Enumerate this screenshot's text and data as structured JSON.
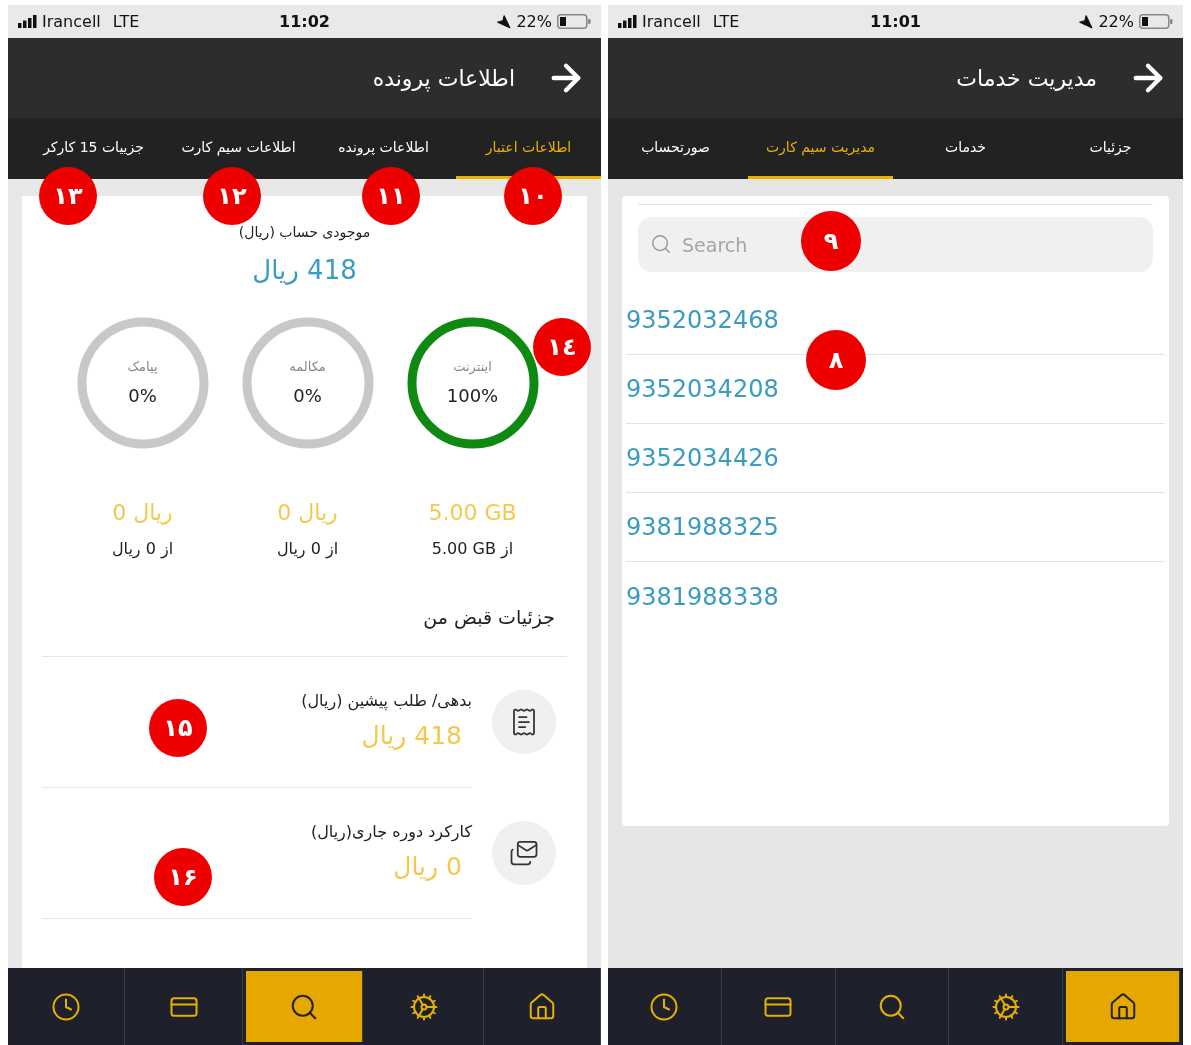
{
  "profile_screen": {
    "status_bar": {
      "carrier": "Irancell",
      "network": "LTE",
      "time": "11:02",
      "battery": "22%"
    },
    "header": {
      "title": "اطلاعات پرونده"
    },
    "tabs": [
      {
        "label": "اطلاعات اعتبار",
        "selected": true
      },
      {
        "label": "اطلاعات پرونده",
        "selected": false
      },
      {
        "label": "اطلاعات سیم کارت",
        "selected": false
      },
      {
        "label": "جزییات 15 کارکر",
        "selected": false
      }
    ],
    "balance": {
      "label": "موجودی حساب (ریال)",
      "amount": "418 ریال"
    },
    "gauges": [
      {
        "label": "اینترنت",
        "percent": "100%",
        "color": "#0e8a12",
        "used": "5.00 GB",
        "total": "5.00 GB از"
      },
      {
        "label": "مکالمه",
        "percent": "0%",
        "color": "#c8c8c8",
        "used": "0 ریال",
        "total": "از 0 ریال"
      },
      {
        "label": "پیامک",
        "percent": "0%",
        "color": "#c8c8c8",
        "used": "0 ریال",
        "total": "از 0 ریال"
      }
    ],
    "bill": {
      "heading": "جزئیات قبض من",
      "rows": [
        {
          "kind": "receipt",
          "title": "بدهی/ طلب پیشین (ریال)",
          "amount": "418 ریال"
        },
        {
          "kind": "payment",
          "title": "کارکرد دوره جاری(ریال)",
          "amount": "0 ریال"
        }
      ]
    },
    "nav": [
      {
        "kind": "clock",
        "selected": false
      },
      {
        "kind": "card",
        "selected": false
      },
      {
        "kind": "search",
        "selected": true
      },
      {
        "kind": "gear",
        "selected": false
      },
      {
        "kind": "home",
        "selected": false
      }
    ],
    "markers": [
      "۱۰",
      "۱۱",
      "۱۲",
      "۱۳",
      "١٤",
      "۱۵",
      "۱۶"
    ]
  },
  "services_screen": {
    "status_bar": {
      "carrier": "Irancell",
      "network": "LTE",
      "time": "11:01",
      "battery": "22%"
    },
    "header": {
      "title": "مدیریت خدمات"
    },
    "tabs": [
      {
        "label": "جزئیات",
        "selected": false
      },
      {
        "label": "خدمات",
        "selected": false
      },
      {
        "label": "مدیریت سیم کارت",
        "selected": true
      },
      {
        "label": "صورتحساب",
        "selected": false
      }
    ],
    "search": {
      "placeholder": "Search"
    },
    "numbers": [
      "9352032468",
      "9352034208",
      "9352034426",
      "9381988325",
      "9381988338"
    ],
    "nav": [
      {
        "kind": "clock",
        "selected": false
      },
      {
        "kind": "card",
        "selected": false
      },
      {
        "kind": "search",
        "selected": false
      },
      {
        "kind": "gear",
        "selected": false
      },
      {
        "kind": "home",
        "selected": true
      }
    ],
    "markers": [
      "۹",
      "۸"
    ]
  }
}
